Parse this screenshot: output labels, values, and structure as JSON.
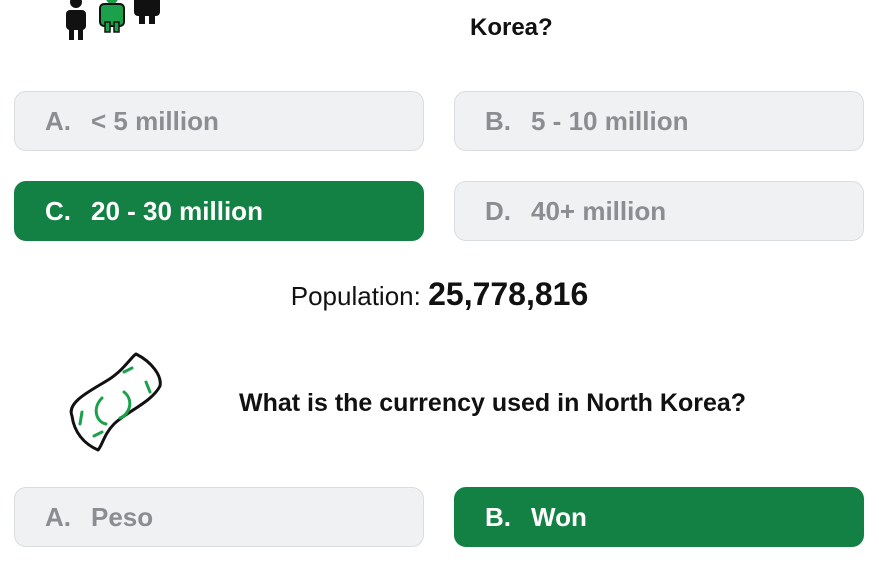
{
  "question1": {
    "title_visible": "Korea?",
    "options": [
      {
        "letter": "A.",
        "label": "< 5 million",
        "correct": false
      },
      {
        "letter": "B.",
        "label": "5 - 10 million",
        "correct": false
      },
      {
        "letter": "C.",
        "label": "20 - 30 million",
        "correct": true
      },
      {
        "letter": "D.",
        "label": "40+ million",
        "correct": false
      }
    ],
    "icon": "people-icon"
  },
  "population": {
    "label": "Population:",
    "value": "25,778,816"
  },
  "question2": {
    "title": "What is the currency used in North Korea?",
    "icon": "money-icon",
    "options": [
      {
        "letter": "A.",
        "label": "Peso",
        "correct": false
      },
      {
        "letter": "B.",
        "label": "Won",
        "correct": true
      }
    ]
  },
  "colors": {
    "correct_bg": "#138044",
    "option_bg": "#f0f1f3",
    "option_text": "#8a8d91",
    "icon_green": "#1aa14a"
  }
}
